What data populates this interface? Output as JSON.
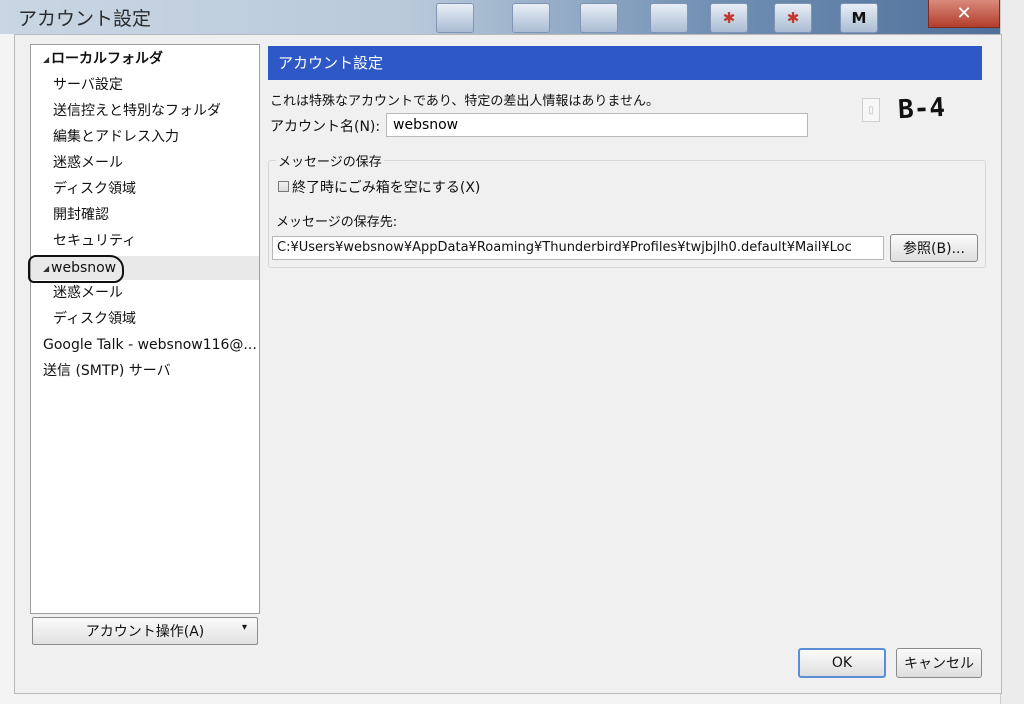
{
  "window": {
    "title": "アカウント設定",
    "close_glyph": "✕",
    "taskbar_tiles": [
      "",
      "",
      "",
      "",
      "M",
      ""
    ]
  },
  "tree": {
    "items": [
      {
        "label": "ローカルフォルダ",
        "level": 0,
        "expanded": true
      },
      {
        "label": "サーバ設定",
        "level": 1
      },
      {
        "label": "送信控えと特別なフォルダ",
        "level": 1
      },
      {
        "label": "編集とアドレス入力",
        "level": 1
      },
      {
        "label": "迷惑メール",
        "level": 1
      },
      {
        "label": "ディスク領域",
        "level": 1
      },
      {
        "label": "開封確認",
        "level": 1
      },
      {
        "label": "セキュリティ",
        "level": 1
      },
      {
        "label": "websnow",
        "level": 0,
        "expanded": true,
        "selected": true
      },
      {
        "label": "迷惑メール",
        "level": 1
      },
      {
        "label": "ディスク領域",
        "level": 1
      },
      {
        "label": "Google Talk - websnow116@...",
        "level": 0
      },
      {
        "label": "送信 (SMTP) サーバ",
        "level": 0
      }
    ],
    "account_actions_label": "アカウント操作(A)"
  },
  "panel": {
    "header": "アカウント設定",
    "description": "これは特殊なアカウントであり、特定の差出人情報はありません。",
    "account_name_label": "アカウント名(N):",
    "account_name_value": "websnow",
    "annotation": "B-4",
    "message_storage": {
      "group_label": "メッセージの保存",
      "empty_trash_label": "終了時にごみ箱を空にする(X)",
      "empty_trash_checked": false,
      "destination_label": "メッセージの保存先:",
      "destination_path": "C:¥Users¥websnow¥AppData¥Roaming¥Thunderbird¥Profiles¥twjbjlh0.default¥Mail¥Loc",
      "browse_label": "参照(B)..."
    }
  },
  "footer": {
    "ok_label": "OK",
    "cancel_label": "キャンセル"
  },
  "colors": {
    "header_blue": "#2f58c7",
    "close_red": "#b43d2c"
  }
}
